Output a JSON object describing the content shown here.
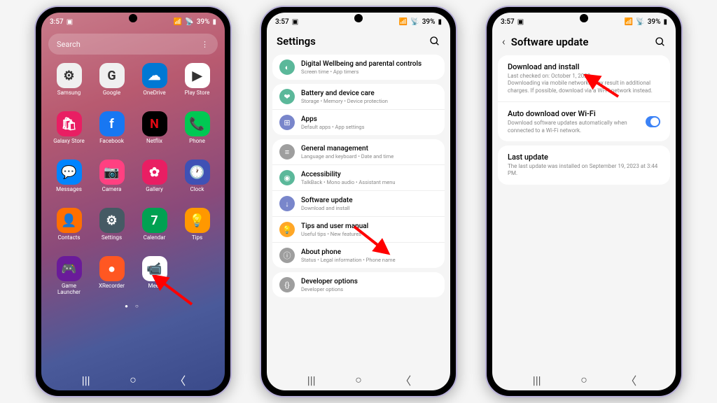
{
  "status": {
    "time": "3:57",
    "battery": "39%"
  },
  "phone1": {
    "search_placeholder": "Search",
    "apps": [
      {
        "label": "Samsung",
        "bg": "#f0f0f0",
        "content": "⚙"
      },
      {
        "label": "Google",
        "bg": "#f0f0f0",
        "content": "G"
      },
      {
        "label": "OneDrive",
        "bg": "#0078d4",
        "content": "☁"
      },
      {
        "label": "Play Store",
        "bg": "#fff",
        "content": "▶"
      },
      {
        "label": "Galaxy Store",
        "bg": "#e91e63",
        "content": "🛍"
      },
      {
        "label": "Facebook",
        "bg": "#1877f2",
        "content": "f"
      },
      {
        "label": "Netflix",
        "bg": "#000",
        "content": "N"
      },
      {
        "label": "Phone",
        "bg": "#00c853",
        "content": "📞"
      },
      {
        "label": "Messages",
        "bg": "#0084ff",
        "content": "💬"
      },
      {
        "label": "Camera",
        "bg": "#ff4081",
        "content": "📷"
      },
      {
        "label": "Gallery",
        "bg": "#e91e63",
        "content": "✿"
      },
      {
        "label": "Clock",
        "bg": "#3f51b5",
        "content": "🕐"
      },
      {
        "label": "Contacts",
        "bg": "#ff6f00",
        "content": "👤"
      },
      {
        "label": "Settings",
        "bg": "#455a64",
        "content": "⚙"
      },
      {
        "label": "Calendar",
        "bg": "#00a152",
        "content": "7"
      },
      {
        "label": "Tips",
        "bg": "#ff9800",
        "content": "💡"
      },
      {
        "label": "Game Launcher",
        "bg": "#6a1b9a",
        "content": "🎮"
      },
      {
        "label": "XRecorder",
        "bg": "#ff5722",
        "content": "●"
      },
      {
        "label": "Meet",
        "bg": "#fff",
        "content": "📹"
      }
    ]
  },
  "phone2": {
    "title": "Settings",
    "items": [
      {
        "title": "Digital Wellbeing and parental controls",
        "sub": "Screen time • App timers",
        "icon_bg": "#5bb89a",
        "icon": "◐"
      },
      {
        "title": "Battery and device care",
        "sub": "Storage • Memory • Device protection",
        "icon_bg": "#5bb89a",
        "icon": "❤"
      },
      {
        "title": "Apps",
        "sub": "Default apps • App settings",
        "icon_bg": "#7986cb",
        "icon": "⊞"
      },
      {
        "title": "General management",
        "sub": "Language and keyboard • Date and time",
        "icon_bg": "#9e9e9e",
        "icon": "≡"
      },
      {
        "title": "Accessibility",
        "sub": "TalkBack • Mono audio • Assistant menu",
        "icon_bg": "#5bb89a",
        "icon": "◉"
      },
      {
        "title": "Software update",
        "sub": "Download and install",
        "icon_bg": "#7986cb",
        "icon": "↓"
      },
      {
        "title": "Tips and user manual",
        "sub": "Useful tips • New features",
        "icon_bg": "#ffa726",
        "icon": "💡"
      },
      {
        "title": "About phone",
        "sub": "Status • Legal information • Phone name",
        "icon_bg": "#9e9e9e",
        "icon": "ⓘ"
      },
      {
        "title": "Developer options",
        "sub": "Developer options",
        "icon_bg": "#9e9e9e",
        "icon": "{}"
      }
    ]
  },
  "phone3": {
    "title": "Software update",
    "items": [
      {
        "title": "Download and install",
        "sub": "Last checked on: October 1, 2023\nDownloading via mobile networks may result in additional charges. If possible, download via a Wi-Fi network instead."
      },
      {
        "title": "Auto download over Wi-Fi",
        "sub": "Download software updates automatically when connected to a Wi-Fi network.",
        "toggle": true
      },
      {
        "title": "Last update",
        "sub": "The last update was installed on September 19, 2023 at 3:44 PM."
      }
    ]
  }
}
